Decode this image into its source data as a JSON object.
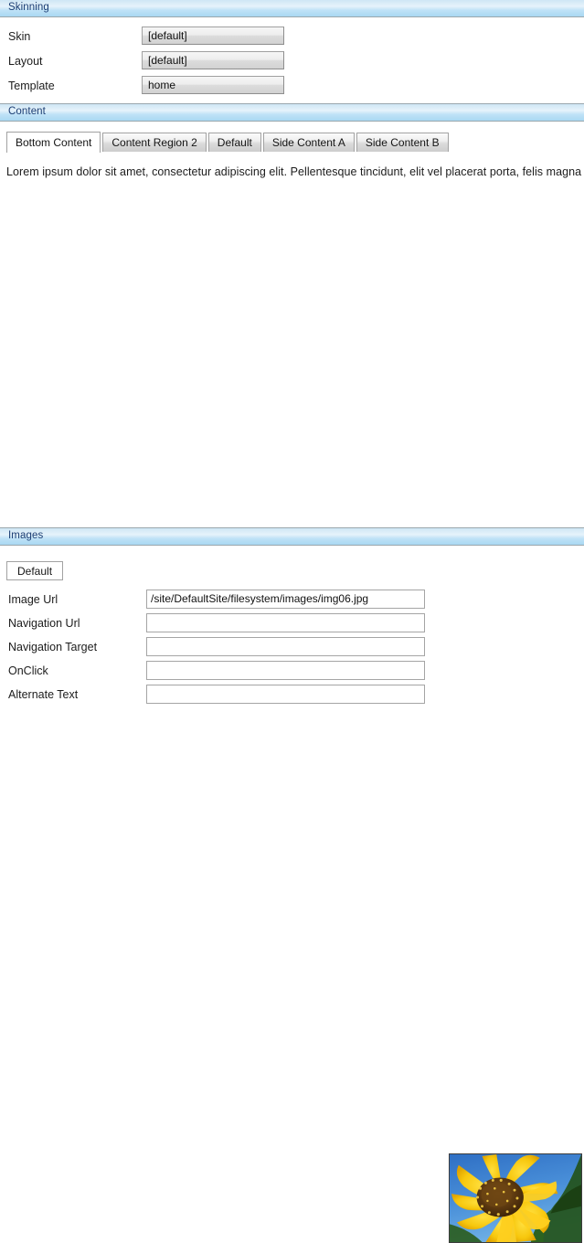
{
  "skinning": {
    "header": "Skinning",
    "fields": [
      {
        "label": "Skin",
        "value": "[default]"
      },
      {
        "label": "Layout",
        "value": "[default]"
      },
      {
        "label": "Template",
        "value": "home"
      }
    ]
  },
  "content": {
    "header": "Content",
    "tabs": [
      {
        "label": "Bottom Content",
        "active": true
      },
      {
        "label": "Content Region 2",
        "active": false
      },
      {
        "label": "Default",
        "active": false
      },
      {
        "label": "Side Content A",
        "active": false
      },
      {
        "label": "Side Content B",
        "active": false
      }
    ],
    "body_text": "Lorem ipsum dolor sit amet, consectetur adipiscing elit. Pellentesque tincidunt, elit vel placerat porta, felis magna"
  },
  "images": {
    "header": "Images",
    "tab_label": "Default",
    "fields": [
      {
        "label": "Image Url",
        "value": "/site/DefaultSite/filesystem/images/img06.jpg"
      },
      {
        "label": "Navigation Url",
        "value": ""
      },
      {
        "label": "Navigation Target",
        "value": ""
      },
      {
        "label": "OnClick",
        "value": ""
      },
      {
        "label": "Alternate Text",
        "value": ""
      }
    ],
    "thumbnail_alt": "sunflower-photo"
  },
  "colors": {
    "header_bar_top": "#cfe6f5",
    "header_bar_bottom": "#a9d8f2",
    "header_text": "#1b3d73",
    "border_gray": "#9aa7ad",
    "sky_blue": "#3f86cf",
    "petal_yellow": "#f2c40f",
    "disc_brown": "#5d3a12",
    "leaf_green": "#2f5d1e"
  }
}
